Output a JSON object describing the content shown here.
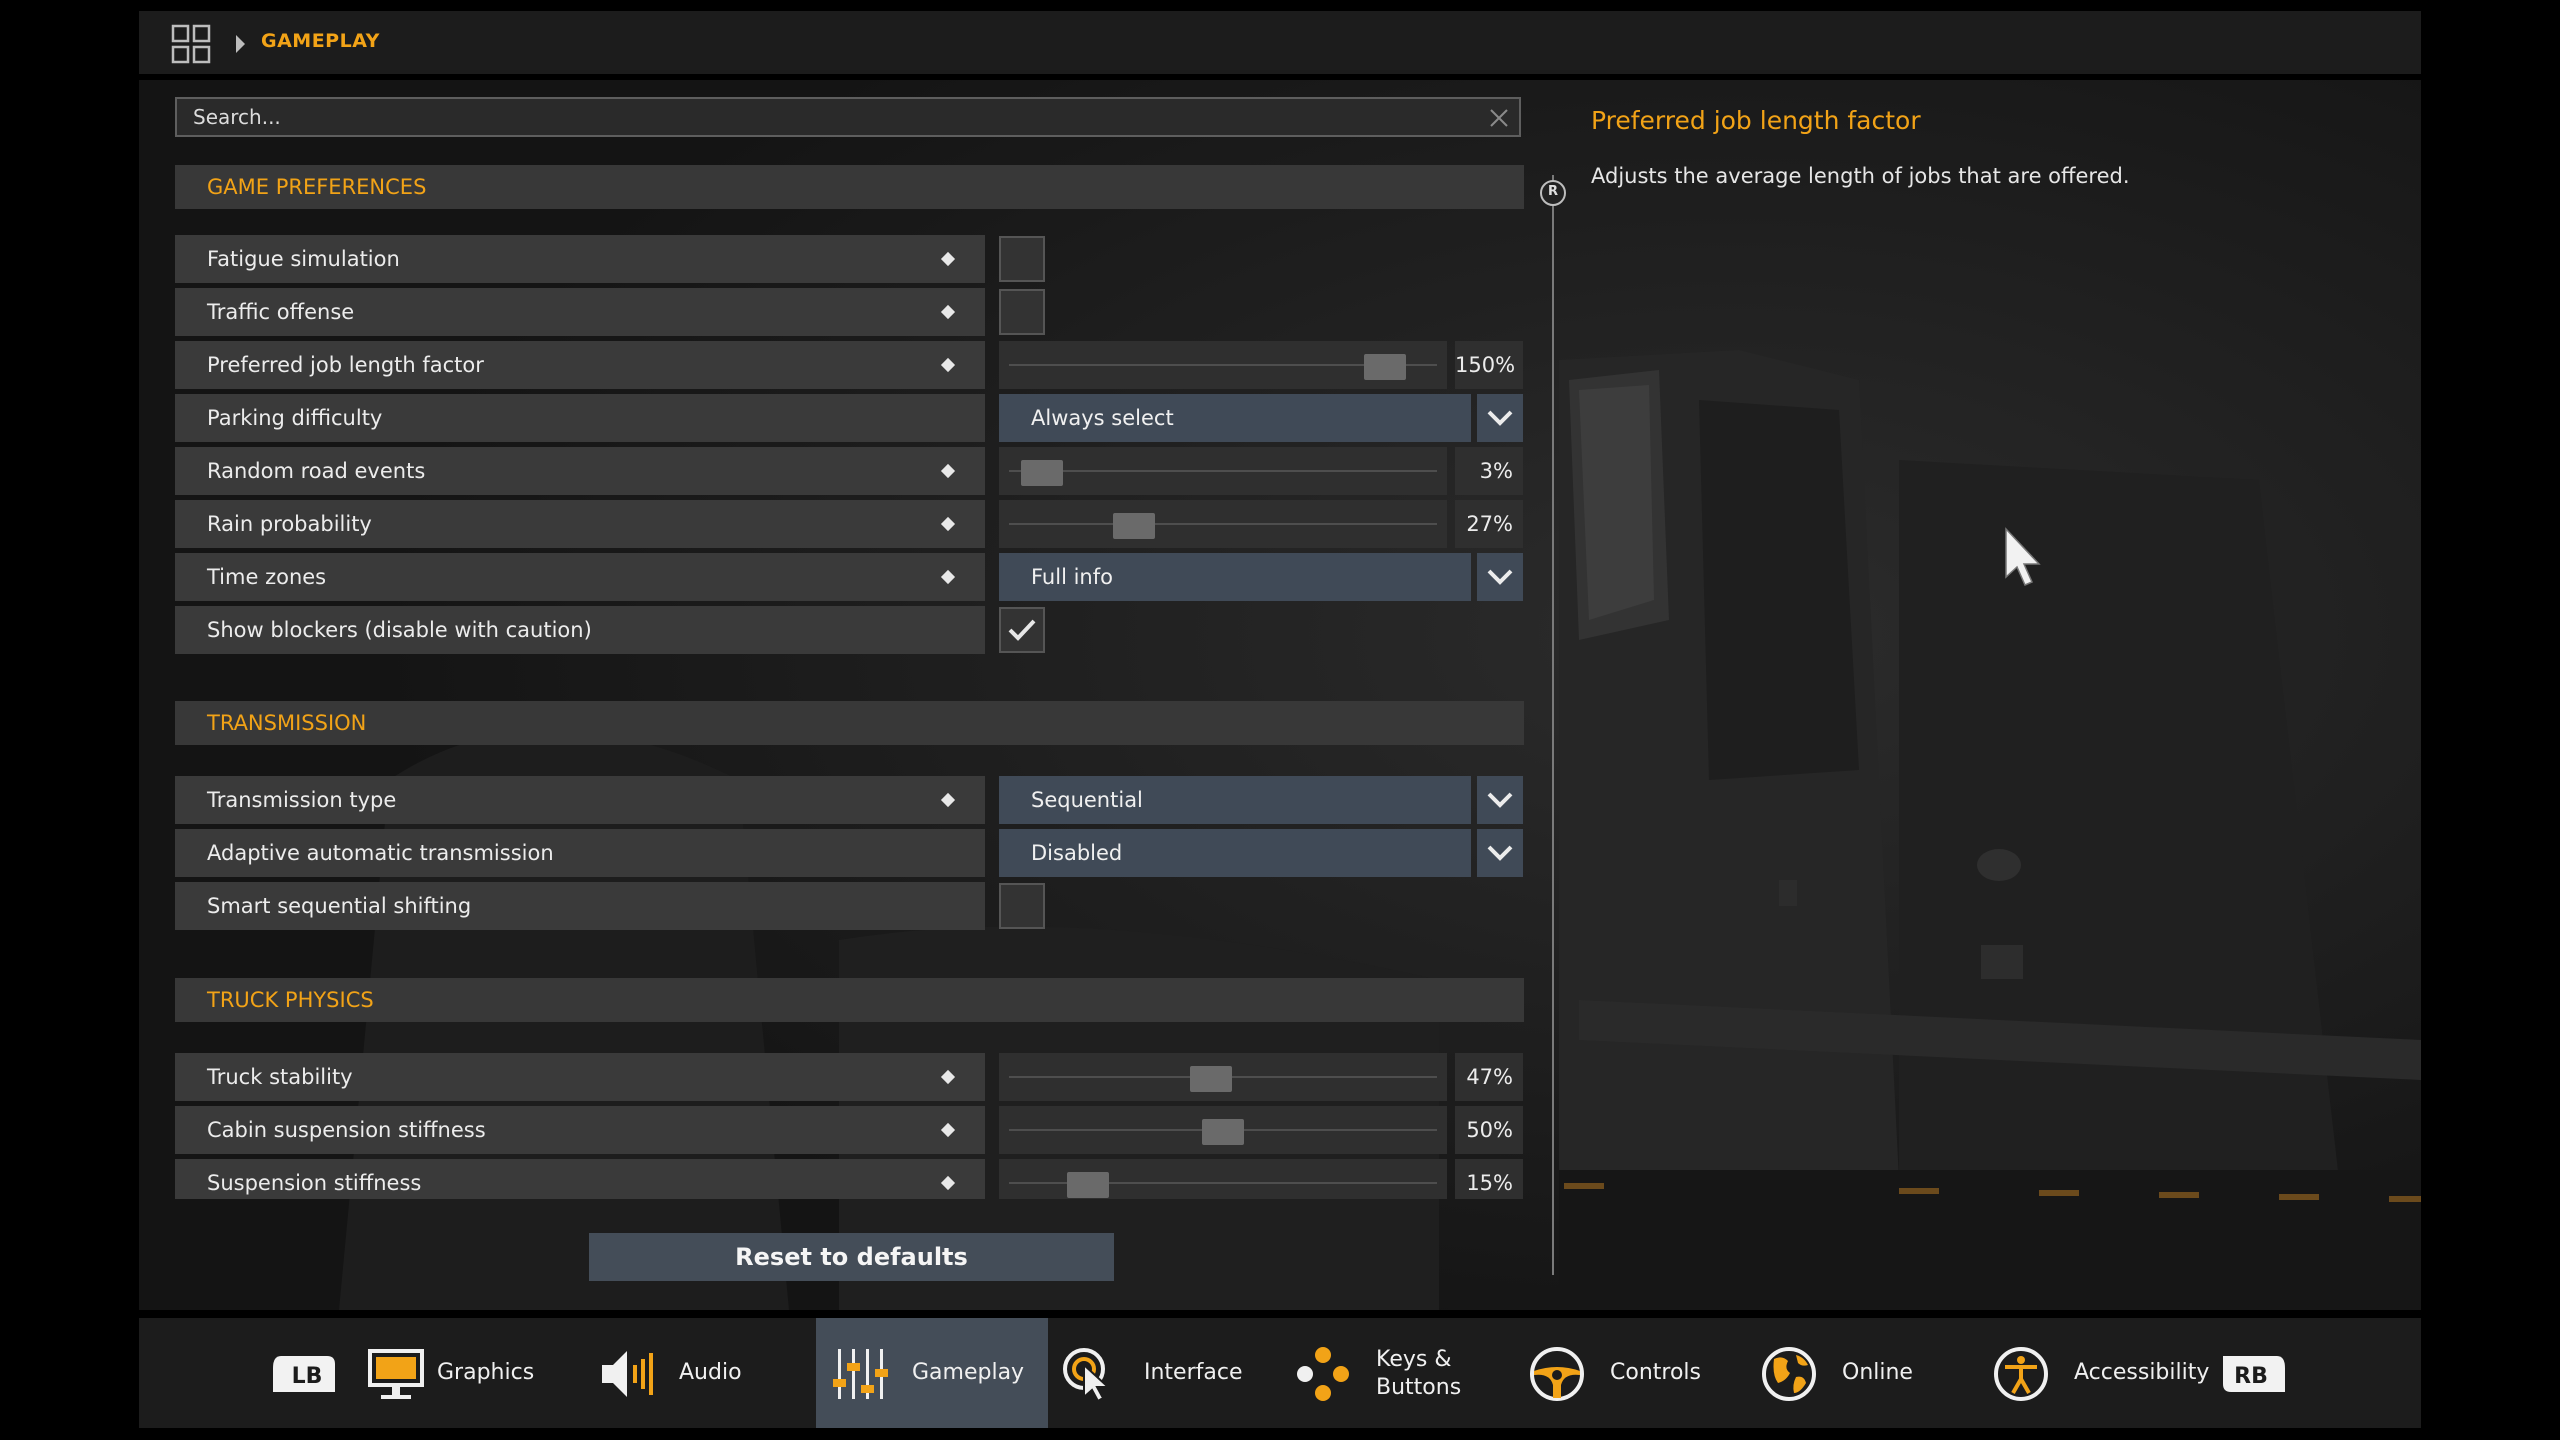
{
  "breadcrumb": {
    "label": "GAMEPLAY"
  },
  "search": {
    "placeholder": "Search..."
  },
  "sections": {
    "game_preferences": "GAME PREFERENCES",
    "transmission": "TRANSMISSION",
    "truck_physics": "TRUCK PHYSICS"
  },
  "settings": {
    "fatigue": {
      "label": "Fatigue simulation",
      "checked": false
    },
    "traffic": {
      "label": "Traffic offense",
      "checked": false
    },
    "job_length": {
      "label": "Preferred job length factor",
      "value": "150%",
      "level": 0.92
    },
    "parking": {
      "label": "Parking difficulty",
      "value": "Always select"
    },
    "road_events": {
      "label": "Random road events",
      "value": "3%",
      "level": 0.03
    },
    "rain": {
      "label": "Rain probability",
      "value": "27%",
      "level": 0.27
    },
    "time_zones": {
      "label": "Time zones",
      "value": "Full info"
    },
    "blockers": {
      "label": "Show blockers (disable with caution)",
      "checked": true
    },
    "transmission_type": {
      "label": "Transmission type",
      "value": "Sequential"
    },
    "adaptive": {
      "label": "Adaptive automatic transmission",
      "value": "Disabled"
    },
    "smart_seq": {
      "label": "Smart sequential shifting",
      "checked": false
    },
    "truck_stability": {
      "label": "Truck stability",
      "value": "47%",
      "level": 0.47
    },
    "cabin_susp": {
      "label": "Cabin suspension stiffness",
      "value": "50%",
      "level": 0.5
    },
    "susp": {
      "label": "Suspension stiffness",
      "value": "15%",
      "level": 0.15
    }
  },
  "reset_label": "Reset to defaults",
  "info": {
    "title": "Preferred job length factor",
    "description": "Adjusts the average length of jobs that are offered.",
    "knob_letter": "R"
  },
  "nav": {
    "lb": "LB",
    "rb": "RB",
    "tabs": [
      {
        "label": "Graphics"
      },
      {
        "label": "Audio"
      },
      {
        "label": "Gameplay"
      },
      {
        "label": "Interface"
      },
      {
        "label_line1": "Keys &",
        "label_line2": "Buttons"
      },
      {
        "label": "Controls"
      },
      {
        "label": "Online"
      },
      {
        "label": "Accessibility"
      }
    ],
    "active": "Gameplay"
  },
  "colors": {
    "accent": "#f2a317",
    "dropdown": "#404a57",
    "panel": "#1b1b1b"
  }
}
